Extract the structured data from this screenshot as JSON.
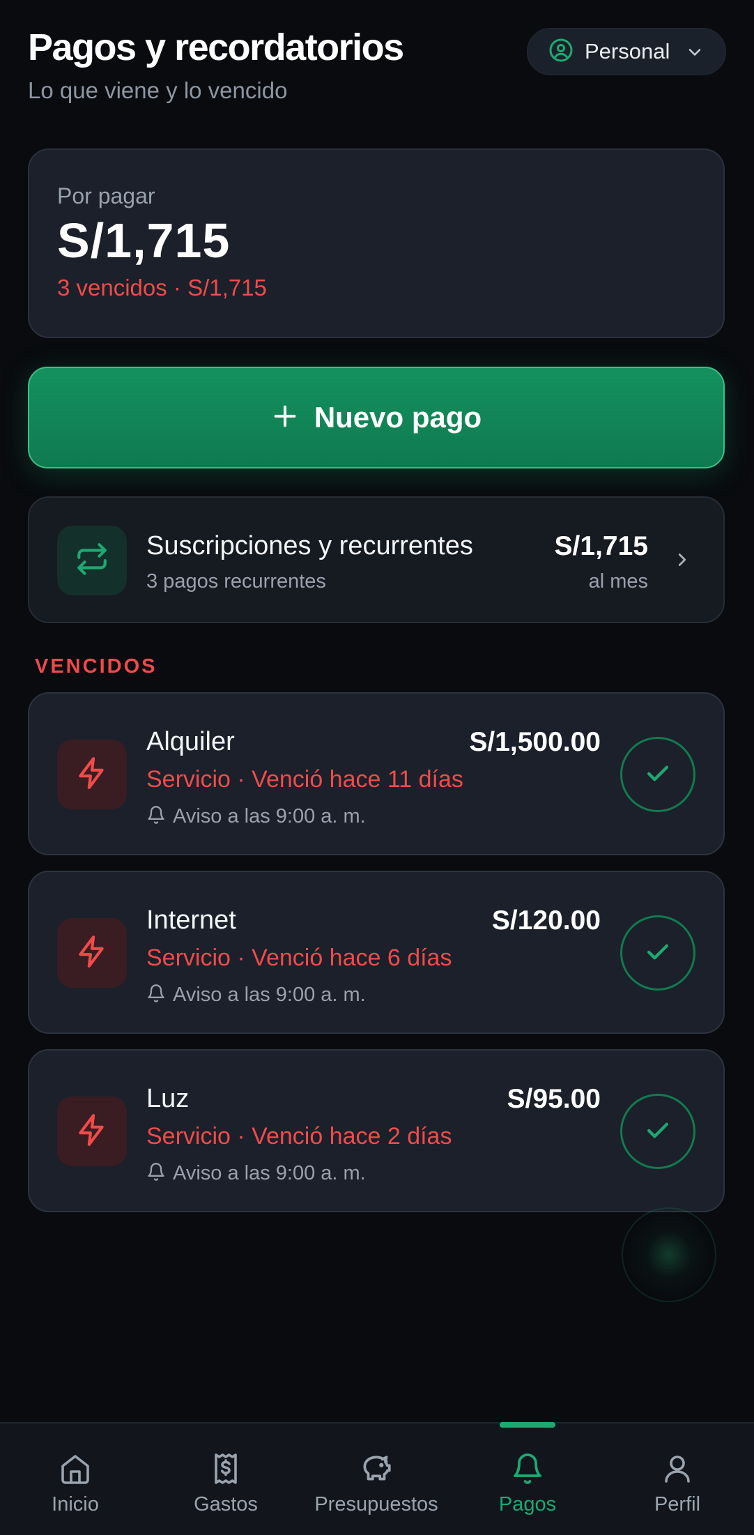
{
  "header": {
    "title": "Pagos y recordatorios",
    "subtitle": "Lo que viene y lo vencido",
    "profile": {
      "label": "Personal",
      "icon": "user-circle-icon"
    }
  },
  "summary": {
    "label": "Por pagar",
    "amount": "S/1,715",
    "overdue": "3 vencidos · S/1,715"
  },
  "new_payment": {
    "label": "Nuevo pago",
    "icon": "plus-icon"
  },
  "subscriptions": {
    "title": "Suscripciones y recurrentes",
    "count": "3 pagos recurrentes",
    "amount": "S/1,715",
    "period": "al mes",
    "icon": "repeat-icon"
  },
  "overdue_section": {
    "label": "VENCIDOS",
    "items": [
      {
        "name": "Alquiler",
        "amount": "S/1,500.00",
        "status": "Servicio · Venció hace 11 días",
        "reminder": "Aviso a las 9:00 a. m.",
        "icon": "bolt-icon"
      },
      {
        "name": "Internet",
        "amount": "S/120.00",
        "status": "Servicio · Venció hace 6 días",
        "reminder": "Aviso a las 9:00 a. m.",
        "icon": "bolt-icon"
      },
      {
        "name": "Luz",
        "amount": "S/95.00",
        "status": "Servicio · Venció hace 2 días",
        "reminder": "Aviso a las 9:00 a. m.",
        "icon": "bolt-icon"
      }
    ]
  },
  "tabbar": {
    "active": "Pagos",
    "items": [
      {
        "label": "Inicio",
        "icon": "home-icon"
      },
      {
        "label": "Gastos",
        "icon": "receipt-icon"
      },
      {
        "label": "Presupuestos",
        "icon": "piggy-bank-icon"
      },
      {
        "label": "Pagos",
        "icon": "bell-icon"
      },
      {
        "label": "Perfil",
        "icon": "user-icon"
      }
    ]
  },
  "colors": {
    "background": "#090b0f",
    "card": "#1b202a",
    "accent_green": "#1fa872",
    "danger_red": "#f04b4b",
    "muted_text": "#98a1ad"
  }
}
